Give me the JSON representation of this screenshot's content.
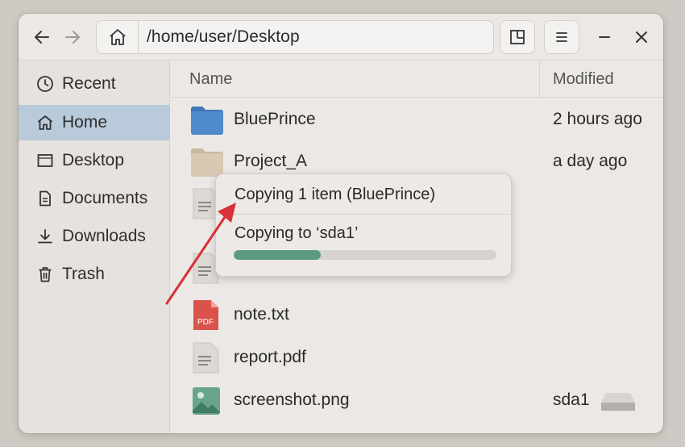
{
  "header": {
    "path": "/home/user/Desktop",
    "back_icon": "arrow-left-icon",
    "forward_icon": "arrow-right-icon",
    "home_icon": "home-icon",
    "view_icon": "view-layout-icon",
    "menu_icon": "hamburger-menu-icon",
    "minimize_icon": "minimize-icon",
    "close_icon": "close-icon"
  },
  "sidebar": {
    "items": [
      {
        "label": "Recent",
        "icon": "clock-icon",
        "active": false
      },
      {
        "label": "Home",
        "icon": "home-icon",
        "active": true
      },
      {
        "label": "Desktop",
        "icon": "desktop-icon",
        "active": false
      },
      {
        "label": "Documents",
        "icon": "document-icon",
        "active": false
      },
      {
        "label": "Downloads",
        "icon": "download-icon",
        "active": false
      },
      {
        "label": "Trash",
        "icon": "trash-icon",
        "active": false
      }
    ]
  },
  "columns": {
    "name": "Name",
    "modified": "Modified"
  },
  "files": [
    {
      "name": "BluePrince",
      "modified": "2 hours ago",
      "icon": "folder-blue-icon"
    },
    {
      "name": "Project_A",
      "modified": "a day ago",
      "icon": "folder-beige-icon"
    },
    {
      "name": "",
      "modified": "",
      "icon": "text-file-icon"
    },
    {
      "name": "",
      "modified": "",
      "icon": "text-file-icon"
    },
    {
      "name": "note.txt",
      "modified": "",
      "icon": "pdf-file-icon",
      "icon_label": "PDF"
    },
    {
      "name": "report.pdf",
      "modified": "",
      "icon": "text-file-icon"
    },
    {
      "name": "screenshot.png",
      "modified": "sda1",
      "icon": "image-file-icon"
    }
  ],
  "popover": {
    "title": "Copying 1 item (BluePrince)",
    "subtitle": "Copying to ‘sda1’",
    "progress": 0.33
  },
  "colors": {
    "accent_selected": "#b9cadb",
    "progress": "#5c9a80",
    "arrow": "#d9303a",
    "folder_blue": "#4a82c4",
    "pdf_red": "#d9534a"
  }
}
